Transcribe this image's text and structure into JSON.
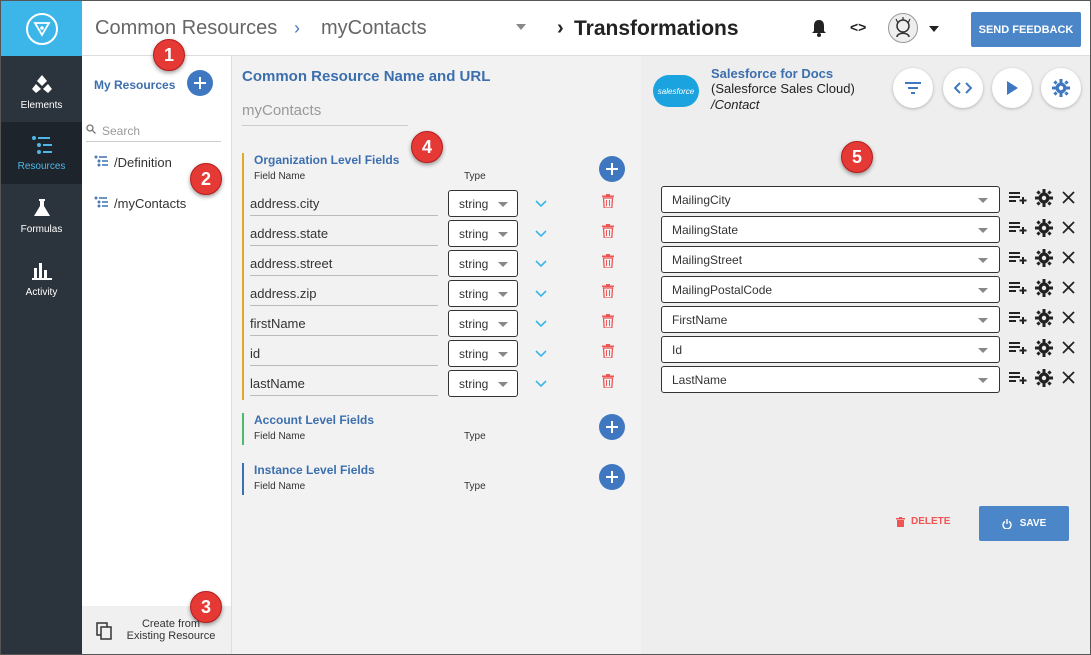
{
  "rail": {
    "items": [
      {
        "label": "Elements",
        "icon": "elements-icon"
      },
      {
        "label": "Resources",
        "icon": "resources-icon",
        "active": true
      },
      {
        "label": "Formulas",
        "icon": "flask-icon"
      },
      {
        "label": "Activity",
        "icon": "bar-chart-icon"
      }
    ]
  },
  "header": {
    "crumb1": "Common Resources",
    "crumb_sep": "›",
    "crumb2": "myContacts",
    "crumb_sep2": "›",
    "crumb3": "Transformations",
    "code_symbol": "<>",
    "feedback_label": "SEND FEEDBACK"
  },
  "resources": {
    "title": "My Resources",
    "search_placeholder": "Search",
    "items": [
      "/Definition",
      "/myContacts"
    ],
    "footer_line1": "Create from",
    "footer_line2": "Existing Resource"
  },
  "middle": {
    "title": "Common Resource Name and URL",
    "resource_name": "myContacts",
    "sections": [
      {
        "title": "Organization Level Fields",
        "col_field": "Field Name",
        "col_type": "Type",
        "color": "#e0a92a"
      },
      {
        "title": "Account Level Fields",
        "col_field": "Field Name",
        "col_type": "Type",
        "color": "#4fb86a"
      },
      {
        "title": "Instance Level Fields",
        "col_field": "Field Name",
        "col_type": "Type",
        "color": "#3c6fae"
      }
    ],
    "fields": [
      {
        "name": "address.city",
        "type": "string"
      },
      {
        "name": "address.state",
        "type": "string"
      },
      {
        "name": "address.street",
        "type": "string"
      },
      {
        "name": "address.zip",
        "type": "string"
      },
      {
        "name": "firstName",
        "type": "string"
      },
      {
        "name": "id",
        "type": "string"
      },
      {
        "name": "lastName",
        "type": "string"
      }
    ]
  },
  "right": {
    "logo_text": "salesforce",
    "title": "Salesforce for Docs",
    "subtitle": "(Salesforce Sales Cloud)",
    "path": "/Contact",
    "mappings": [
      "MailingCity",
      "MailingState",
      "MailingStreet",
      "MailingPostalCode",
      "FirstName",
      "Id",
      "LastName"
    ],
    "delete_label": "DELETE",
    "save_label": "SAVE"
  },
  "callouts": [
    "1",
    "2",
    "3",
    "4",
    "5"
  ],
  "colors": {
    "accent": "#4a86c8",
    "rail_bg": "#2b333c",
    "logo_bg": "#3cb6e8",
    "callout": "#e53935",
    "delete": "#e55555"
  }
}
